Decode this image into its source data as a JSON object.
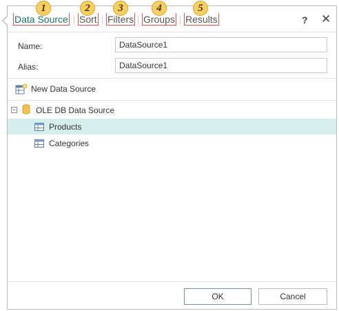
{
  "tabs": [
    {
      "label": "Data Source",
      "badge": "1",
      "active": true
    },
    {
      "label": "Sort",
      "badge": "2",
      "active": false
    },
    {
      "label": "Filters",
      "badge": "3",
      "active": false
    },
    {
      "label": "Groups",
      "badge": "4",
      "active": false
    },
    {
      "label": "Results",
      "badge": "5",
      "active": false
    }
  ],
  "header": {
    "help_label": "?",
    "close_label": "✕"
  },
  "fields": {
    "name": {
      "label": "Name:",
      "value": "DataSource1"
    },
    "alias": {
      "label": "Alias:",
      "value": "DataSource1"
    }
  },
  "toolbar": {
    "new_data_source_label": "New Data Source"
  },
  "tree": {
    "root": {
      "label": "OLE DB Data Source",
      "toggle": "−",
      "icon": "database-icon"
    },
    "items": [
      {
        "label": "Products",
        "icon": "table-icon",
        "selected": true
      },
      {
        "label": "Categories",
        "icon": "table-icon",
        "selected": false
      }
    ]
  },
  "footer": {
    "ok_label": "OK",
    "cancel_label": "Cancel"
  },
  "colors": {
    "accent": "#1f6e64",
    "selection": "#d6efec",
    "badge": "#f7cf62"
  }
}
